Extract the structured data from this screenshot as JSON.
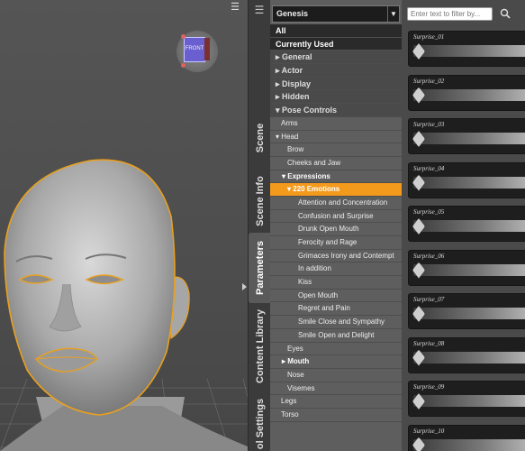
{
  "tree": {
    "selector_value": "Genesis",
    "items": [
      {
        "label": "All",
        "level": "cat"
      },
      {
        "label": "Currently Used",
        "level": "cat"
      },
      {
        "label": "▸ General",
        "level": "grp"
      },
      {
        "label": "▸ Actor",
        "level": "grp"
      },
      {
        "label": "▸ Display",
        "level": "grp"
      },
      {
        "label": "▸ Hidden",
        "level": "grp"
      },
      {
        "label": "▾ Pose Controls",
        "level": "grp"
      },
      {
        "label": "Arms",
        "level": "sub",
        "indent": 12
      },
      {
        "label": "▾ Head",
        "level": "sub",
        "indent": 6
      },
      {
        "label": "Brow",
        "level": "sub",
        "indent": 19
      },
      {
        "label": "Cheeks and Jaw",
        "level": "sub",
        "indent": 19
      },
      {
        "label": "▾ Expressions",
        "level": "sub bold",
        "indent": 13
      },
      {
        "label": "▾ 220 Emotions",
        "level": "sel",
        "indent": 19
      },
      {
        "label": "Attention and Concentration",
        "level": "sub",
        "indent": 31
      },
      {
        "label": "Confusion and Surprise",
        "level": "sub",
        "indent": 31
      },
      {
        "label": "Drunk Open Mouth",
        "level": "sub",
        "indent": 31
      },
      {
        "label": "Ferocity and Rage",
        "level": "sub",
        "indent": 31
      },
      {
        "label": "Grimaces Irony and Contempt",
        "level": "sub",
        "indent": 31
      },
      {
        "label": "In addition",
        "level": "sub",
        "indent": 31
      },
      {
        "label": "Kiss",
        "level": "sub",
        "indent": 31
      },
      {
        "label": "Open Mouth",
        "level": "sub",
        "indent": 31
      },
      {
        "label": "Regret and Pain",
        "level": "sub",
        "indent": 31
      },
      {
        "label": "Smile Close and Sympathy",
        "level": "sub",
        "indent": 31
      },
      {
        "label": "Smile Open and Delight",
        "level": "sub",
        "indent": 31
      },
      {
        "label": "Eyes",
        "level": "sub",
        "indent": 19
      },
      {
        "label": "▸ Mouth",
        "level": "sub bold",
        "indent": 13
      },
      {
        "label": "Nose",
        "level": "sub",
        "indent": 19
      },
      {
        "label": "Visemes",
        "level": "sub",
        "indent": 19
      },
      {
        "label": "Legs",
        "level": "sub",
        "indent": 12
      },
      {
        "label": "Torso",
        "level": "sub",
        "indent": 12
      }
    ]
  },
  "tabs": [
    {
      "label": "Scene"
    },
    {
      "label": "Scene Info"
    },
    {
      "label": "Parameters",
      "active": true
    },
    {
      "label": "Content Library"
    },
    {
      "label": "ol Settings"
    }
  ],
  "filter": {
    "placeholder": "Enter text to filter by..."
  },
  "sliders": [
    {
      "label": "Surprise_01"
    },
    {
      "label": "Surprise_02"
    },
    {
      "label": "Surprise_03"
    },
    {
      "label": "Surprise_04"
    },
    {
      "label": "Surprise_05"
    },
    {
      "label": "Surprise_06"
    },
    {
      "label": "Surprise_07"
    },
    {
      "label": "Surprise_08"
    },
    {
      "label": "Surprise_09"
    },
    {
      "label": "Surprise_10"
    }
  ],
  "viewport": {
    "cube_label": "FRONT",
    "icons": {
      "menu": "viewport-menu-icon",
      "cube": "view-cube-icon"
    }
  },
  "colors": {
    "selection": "#f39a1d",
    "outline": "#e8a020"
  }
}
